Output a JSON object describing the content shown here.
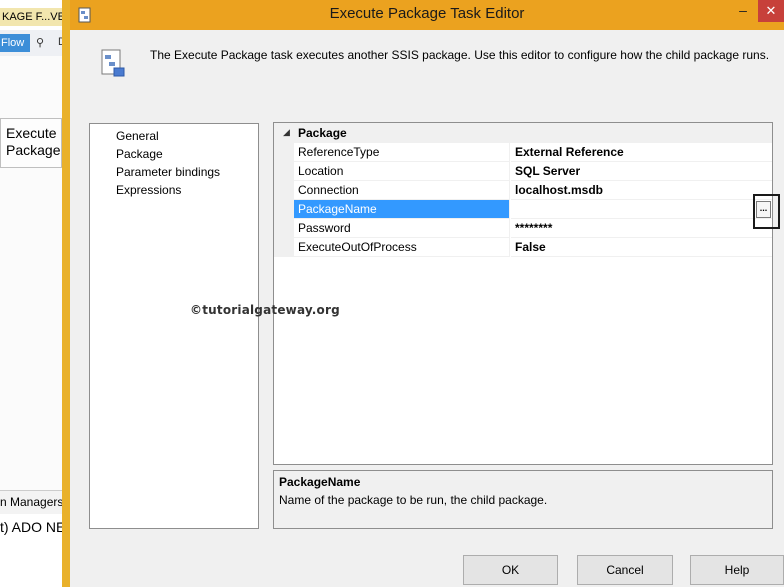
{
  "background_window": {
    "title_fragment": "KAGE F...VE",
    "toolbar_flow": "Flow",
    "toolbar_text": "D",
    "task_label": "Execute\nPackage",
    "tab_fragment": "n Managers",
    "connection_fragment": "t) ADO NE"
  },
  "dialog": {
    "title": "Execute Package Task Editor",
    "minimize_glyph": "–",
    "close_glyph": "✕",
    "description": "The Execute Package task executes another SSIS package. Use this editor to configure how the child package runs."
  },
  "nav": {
    "items": [
      {
        "label": "General"
      },
      {
        "label": "Package"
      },
      {
        "label": "Parameter bindings"
      },
      {
        "label": "Expressions"
      }
    ]
  },
  "grid": {
    "category": "Package",
    "category_arrow": "◢",
    "rows": [
      {
        "name": "ReferenceType",
        "value": "External Reference"
      },
      {
        "name": "Location",
        "value": "SQL Server"
      },
      {
        "name": "Connection",
        "value": "localhost.msdb"
      },
      {
        "name": "PackageName",
        "value": "",
        "selected": true
      },
      {
        "name": "Password",
        "value": "********"
      },
      {
        "name": "ExecuteOutOfProcess",
        "value": "False"
      }
    ],
    "ellipsis_label": "..."
  },
  "watermark": "©tutorialgateway.org",
  "help_panel": {
    "title": "PackageName",
    "text": "Name of the package to be run, the child package."
  },
  "buttons": {
    "ok": "OK",
    "cancel": "Cancel",
    "help": "Help"
  },
  "colors": {
    "titlebar": "#eba21f",
    "selection": "#3399ff",
    "close": "#c7403a"
  }
}
